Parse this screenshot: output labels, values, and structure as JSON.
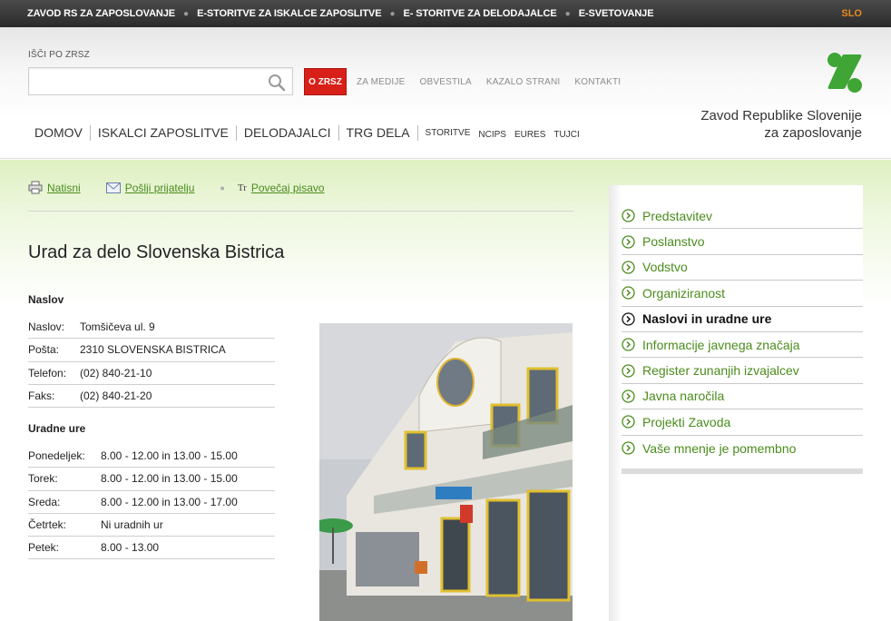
{
  "topbar": {
    "links": [
      "ZAVOD RS ZA ZAPOSLOVANJE",
      "E-STORITVE ZA ISKALCE ZAPOSLITVE",
      "E- STORITVE ZA DELODAJALCE",
      "E-SVETOVANJE"
    ],
    "lang": "SLO"
  },
  "search": {
    "label": "IŠČI PO ZRSZ",
    "value": "",
    "placeholder": ""
  },
  "header_links": {
    "ozrsz": "O ZRSZ",
    "items": [
      "ZA MEDIJE",
      "OBVESTILA",
      "KAZALO STRANI",
      "KONTAKTI"
    ]
  },
  "main_nav": {
    "big": [
      "DOMOV",
      "ISKALCI ZAPOSLITVE",
      "DELODAJALCI",
      "TRG DELA"
    ],
    "small": [
      "STORITVE",
      "NCIPS",
      "EURES",
      "TUJCI"
    ]
  },
  "logo": {
    "line1": "Zavod Republike Slovenije",
    "line2": "za zaposlovanje"
  },
  "tools": {
    "print": "Natisni",
    "send": "Pošlji prijatelju",
    "enlarge": "Povečaj pisavo"
  },
  "page_title": "Urad za delo Slovenska Bistrica",
  "address": {
    "title": "Naslov",
    "rows": [
      {
        "k": "Naslov:",
        "v": "Tomšičeva ul. 9"
      },
      {
        "k": "Pošta:",
        "v": "2310 SLOVENSKA BISTRICA"
      },
      {
        "k": "Telefon:",
        "v": "(02) 840-21-10"
      },
      {
        "k": "Faks:",
        "v": "(02) 840-21-20"
      }
    ]
  },
  "hours": {
    "title": "Uradne ure",
    "rows": [
      {
        "k": "Ponedeljek:",
        "v": "8.00 - 12.00 in 13.00 - 15.00"
      },
      {
        "k": "Torek:",
        "v": "8.00 - 12.00 in 13.00 - 15.00"
      },
      {
        "k": "Sreda:",
        "v": "8.00 - 12.00 in 13.00 - 17.00"
      },
      {
        "k": "Četrtek:",
        "v": "Ni uradnih ur"
      },
      {
        "k": "Petek:",
        "v": "8.00 - 13.00"
      }
    ]
  },
  "sidebar": {
    "items": [
      {
        "label": "Predstavitev",
        "active": false
      },
      {
        "label": "Poslanstvo",
        "active": false
      },
      {
        "label": "Vodstvo",
        "active": false
      },
      {
        "label": "Organiziranost",
        "active": false
      },
      {
        "label": "Naslovi in uradne ure",
        "active": true
      },
      {
        "label": "Informacije javnega značaja",
        "active": false
      },
      {
        "label": "Register zunanjih izvajalcev",
        "active": false
      },
      {
        "label": "Javna naročila",
        "active": false
      },
      {
        "label": "Projekti Zavoda",
        "active": false
      },
      {
        "label": "Vaše mnenje je pomembno",
        "active": false
      }
    ]
  },
  "colors": {
    "accent_green": "#4a8c1c",
    "logo_green": "#3fa535",
    "brand_red": "#d92018",
    "lang_orange": "#e8891c"
  }
}
